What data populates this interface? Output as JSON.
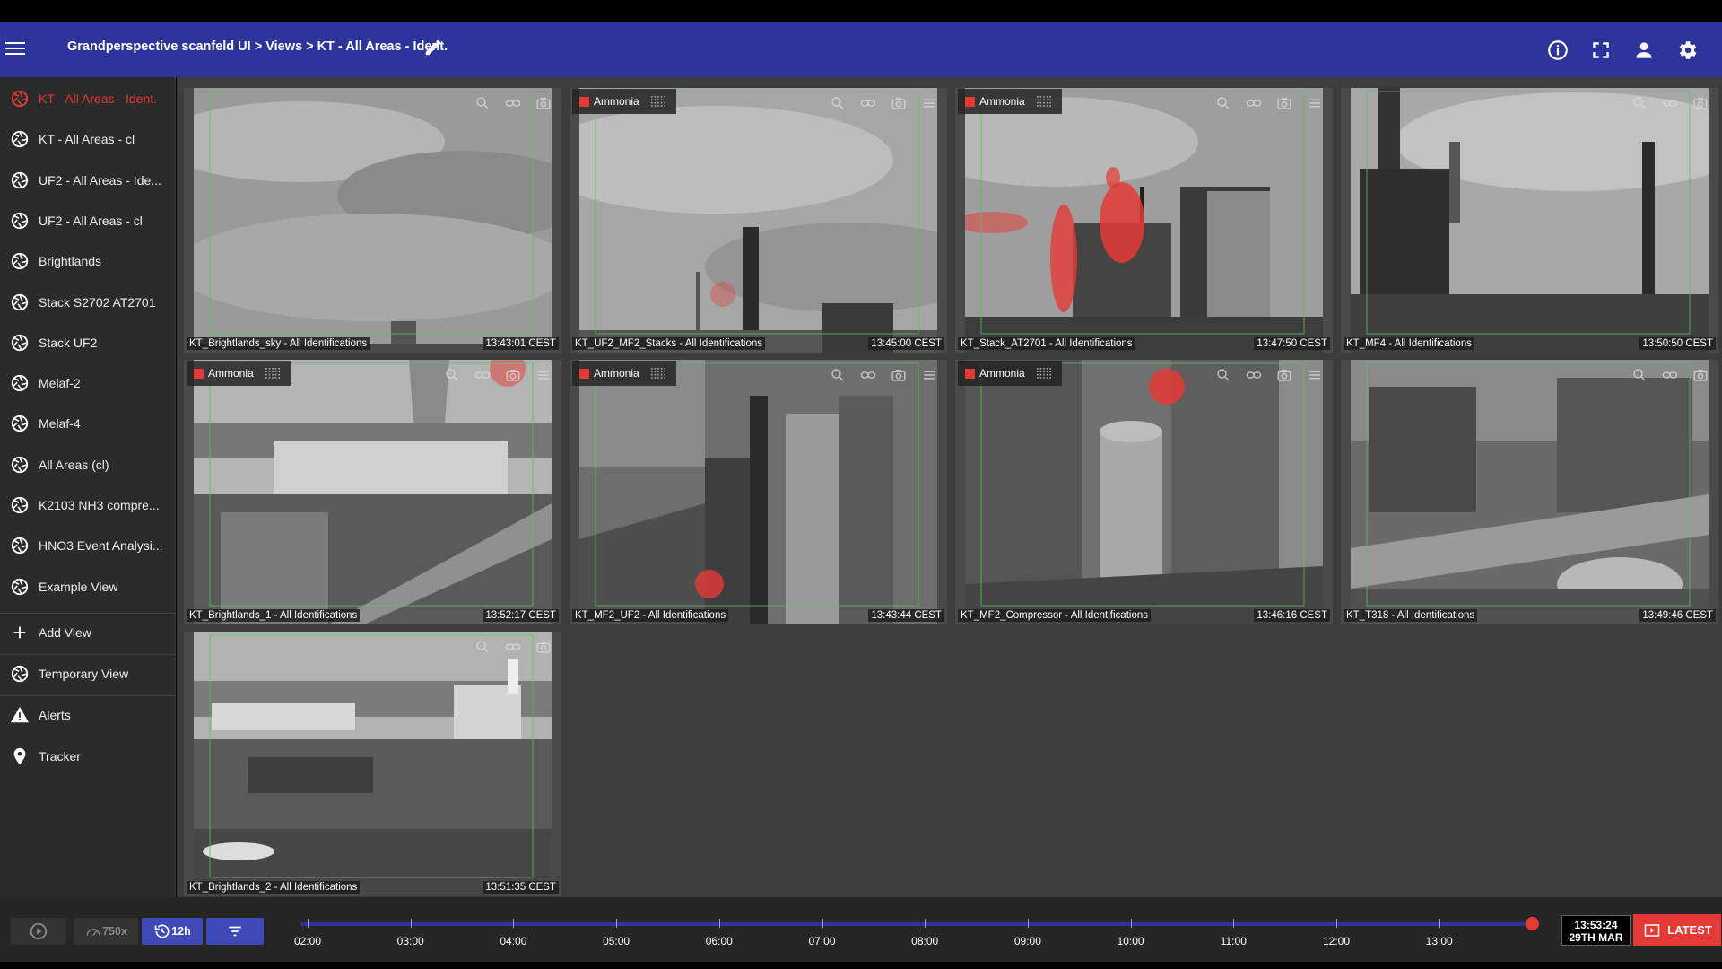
{
  "header": {
    "breadcrumb": "Grandperspective scanfeld UI > Views > KT - All Areas - Ident.",
    "icons": [
      "menu-icon",
      "edit-icon",
      "info-icon",
      "fullscreen-icon",
      "user-icon",
      "settings-icon"
    ]
  },
  "sidebar": {
    "items": [
      {
        "label": "KT - All Areas - Ident.",
        "icon": "aperture-icon",
        "active": true
      },
      {
        "label": "KT - All Areas - cl",
        "icon": "aperture-icon"
      },
      {
        "label": "UF2 - All Areas - Ide...",
        "icon": "aperture-icon"
      },
      {
        "label": "UF2 - All Areas - cl",
        "icon": "aperture-icon"
      },
      {
        "label": "Brightlands",
        "icon": "aperture-icon"
      },
      {
        "label": "Stack S2702 AT2701",
        "icon": "aperture-icon"
      },
      {
        "label": "Stack UF2",
        "icon": "aperture-icon"
      },
      {
        "label": "Melaf-2",
        "icon": "aperture-icon"
      },
      {
        "label": "Melaf-4",
        "icon": "aperture-icon"
      },
      {
        "label": "All Areas (cl)",
        "icon": "aperture-icon"
      },
      {
        "label": "K2103 NH3 compre...",
        "icon": "aperture-icon"
      },
      {
        "label": "HNO3 Event Analysi...",
        "icon": "aperture-icon"
      },
      {
        "label": "Example View",
        "icon": "aperture-icon"
      }
    ],
    "add_view": "Add View",
    "temporary_view": "Temporary View",
    "alerts": "Alerts",
    "tracker": "Tracker"
  },
  "cameras": [
    {
      "name": "KT_Brightlands_sky - All Identifications",
      "time": "13:43:01 CEST",
      "alert": ""
    },
    {
      "name": "KT_UF2_MF2_Stacks - All Identifications",
      "time": "13:45:00 CEST",
      "alert": "Ammonia"
    },
    {
      "name": "KT_Stack_AT2701 - All Identifications",
      "time": "13:47:50 CEST",
      "alert": "Ammonia"
    },
    {
      "name": "KT_MF4 - All Identifications",
      "time": "13:50:50 CEST",
      "alert": ""
    },
    {
      "name": "KT_Brightlands_1 - All Identifications",
      "time": "13:52:17 CEST",
      "alert": "Ammonia"
    },
    {
      "name": "KT_MF2_UF2 - All Identifications",
      "time": "13:43:44 CEST",
      "alert": "Ammonia"
    },
    {
      "name": "KT_MF2_Compressor - All Identifications",
      "time": "13:46:16 CEST",
      "alert": "Ammonia"
    },
    {
      "name": "KT_T318 - All Identifications",
      "time": "13:49:46 CEST",
      "alert": ""
    },
    {
      "name": "KT_Brightlands_2 - All Identifications",
      "time": "13:51:35 CEST",
      "alert": ""
    }
  ],
  "bottom": {
    "speed": "750x",
    "range": "12h",
    "ticks": [
      "02:00",
      "03:00",
      "04:00",
      "05:00",
      "06:00",
      "07:00",
      "08:00",
      "09:00",
      "10:00",
      "11:00",
      "12:00",
      "13:00"
    ],
    "clock_time": "13:53:24",
    "clock_date": "29TH MAR",
    "latest": "LATEST"
  },
  "colors": {
    "header": "#2d359c",
    "alert": "#e53935",
    "sidebar": "#2b2b2b"
  }
}
